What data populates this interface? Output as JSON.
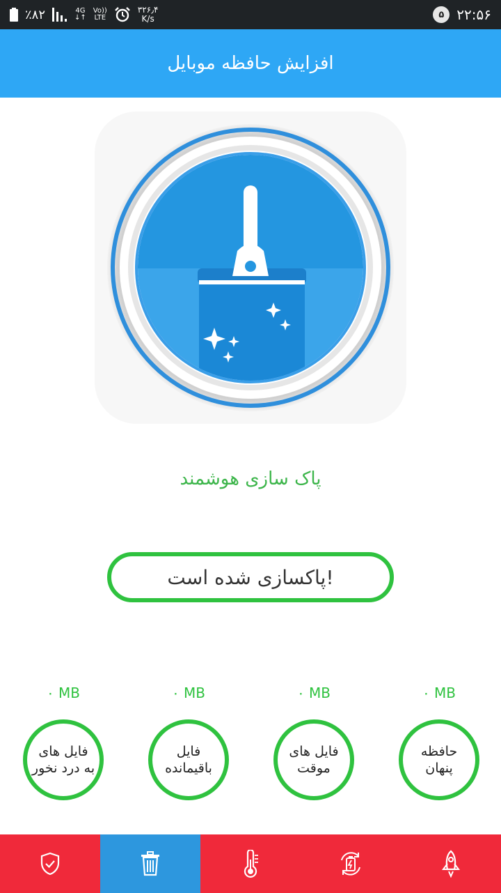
{
  "status_bar": {
    "battery": "٪۸۲",
    "network_top": "4G",
    "volte_top": "Vo))",
    "volte_bottom": "LTE",
    "speed_value": "۳۲۶٫۴",
    "speed_unit": "K/s",
    "notification_count": "۵",
    "clock": "۲۲:۵۶"
  },
  "app_bar": {
    "title": "افزایش حافظه موبایل"
  },
  "main": {
    "feature_label": "پاک سازی هوشمند",
    "status_text": "پاکسازی شده است!"
  },
  "stats": [
    {
      "value": "۰ MB",
      "label": "فایل های\nبه درد نخور"
    },
    {
      "value": "۰ MB",
      "label": "فایل\nباقیمانده"
    },
    {
      "value": "۰ MB",
      "label": "فایل های\nموقت"
    },
    {
      "value": "۰ MB",
      "label": "حافظه\nپنهان"
    }
  ],
  "bottom_nav": [
    {
      "icon": "shield-check-icon",
      "active": false
    },
    {
      "icon": "trash-icon",
      "active": true
    },
    {
      "icon": "thermometer-icon",
      "active": false
    },
    {
      "icon": "battery-refresh-icon",
      "active": false
    },
    {
      "icon": "rocket-icon",
      "active": false
    }
  ],
  "colors": {
    "app_bar": "#2ea7f5",
    "accent_green": "#2fc23f",
    "nav_red": "#f0293a",
    "nav_active": "#2d97de"
  }
}
